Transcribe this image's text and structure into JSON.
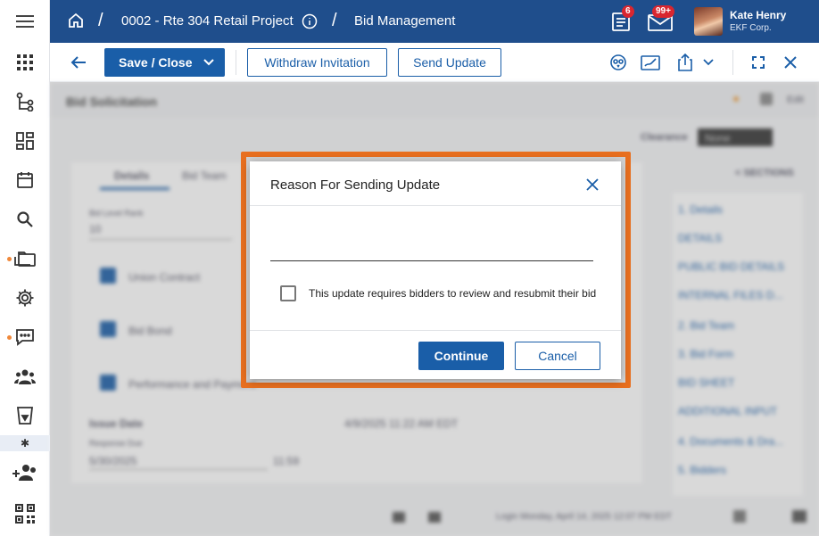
{
  "header": {
    "project": "0002 - Rte 304 Retail Project",
    "module": "Bid Management",
    "tasks_badge": "6",
    "mail_badge": "99+",
    "user_name": "Kate Henry",
    "user_company": "EKF Corp."
  },
  "toolbar": {
    "save_close_label": "Save / Close",
    "withdraw_label": "Withdraw Invitation",
    "send_update_label": "Send Update"
  },
  "background": {
    "section_title": "Bid Solicitation",
    "clearance_label": "Clearance",
    "clearance_value": "None",
    "tabs": [
      "Details",
      "Bid Team"
    ],
    "sections_label": "< SECTIONS",
    "field_label": "Bid Level Rank",
    "field_value": "10",
    "checkboxes": [
      "Union Contract",
      "Bid Bond",
      "Performance and Payment"
    ],
    "issue_date_label": "Issue Date",
    "issue_date_value": "4/9/2025 11:22 AM EDT",
    "response_due_label": "Response Due",
    "response_due_date": "5/30/2025",
    "response_due_time": "11:59",
    "section_links": [
      "1. Details",
      "DETAILS",
      "PUBLIC BID DETAILS",
      "INTERNAL FILES D...",
      "2. Bid Team",
      "3. Bid Form",
      "BID SHEET",
      "ADDITIONAL INPUT",
      "4. Documents & Dra...",
      "5. Bidders"
    ],
    "footer_text": "Login Monday, April 14, 2025 12:07 PM EDT"
  },
  "modal": {
    "title": "Reason For Sending Update",
    "reason_value": "",
    "reason_placeholder": "",
    "checkbox_label": "This update requires bidders to review and resubmit their bid",
    "checkbox_checked": false,
    "continue_label": "Continue",
    "cancel_label": "Cancel"
  },
  "colors": {
    "brand": "#1f4e8c",
    "accent_button": "#1a5ea8",
    "highlight_border": "#e86f1f",
    "badge": "#d9262f"
  }
}
